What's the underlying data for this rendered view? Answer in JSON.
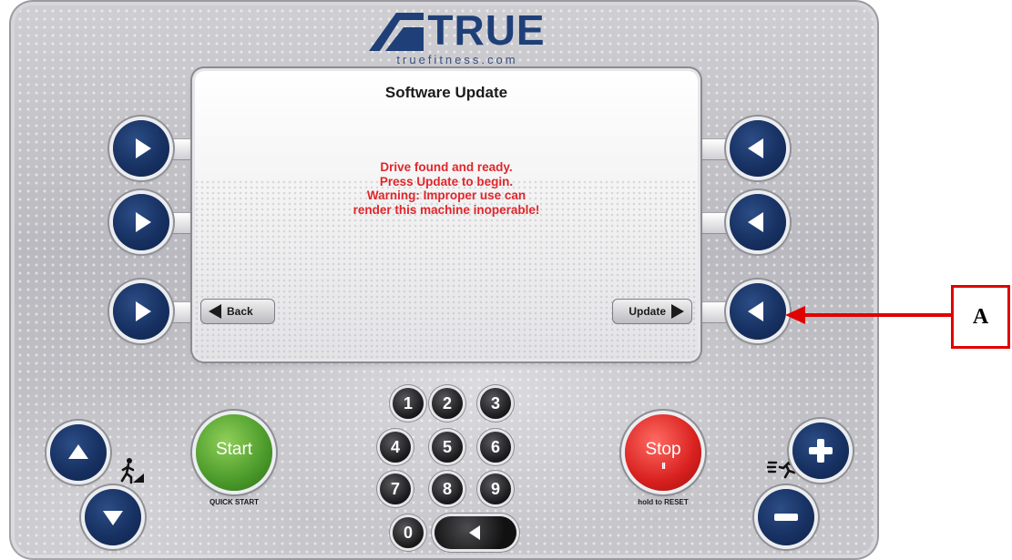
{
  "brand": {
    "name": "TRUE",
    "url": "truefitness.com",
    "color": "#1f3f78"
  },
  "screen": {
    "title": "Software Update",
    "message": [
      "Drive found and ready.",
      "Press Update to begin.",
      "Warning: Improper use can",
      "render this machine inoperable!"
    ],
    "message_color": "#e0262b",
    "back_label": "Back",
    "update_label": "Update"
  },
  "controls": {
    "start_label": "Start",
    "start_caption": "QUICK START",
    "stop_label": "Stop",
    "stop_pause_symbol": "II",
    "stop_caption": "hold to RESET",
    "keypad": [
      "1",
      "2",
      "3",
      "4",
      "5",
      "6",
      "7",
      "8",
      "9",
      "0"
    ]
  },
  "icons": {
    "side_left": "play-right-icon",
    "side_right": "play-left-icon",
    "incline_up": "arrow-up-icon",
    "incline_down": "arrow-down-icon",
    "incline": "incline-walker-icon",
    "speed": "running-person-icon",
    "speed_up": "plus-icon",
    "speed_down": "minus-icon",
    "keypad_back": "backspace-triangle-icon"
  },
  "annotation": {
    "label": "A",
    "color": "#e00000"
  }
}
